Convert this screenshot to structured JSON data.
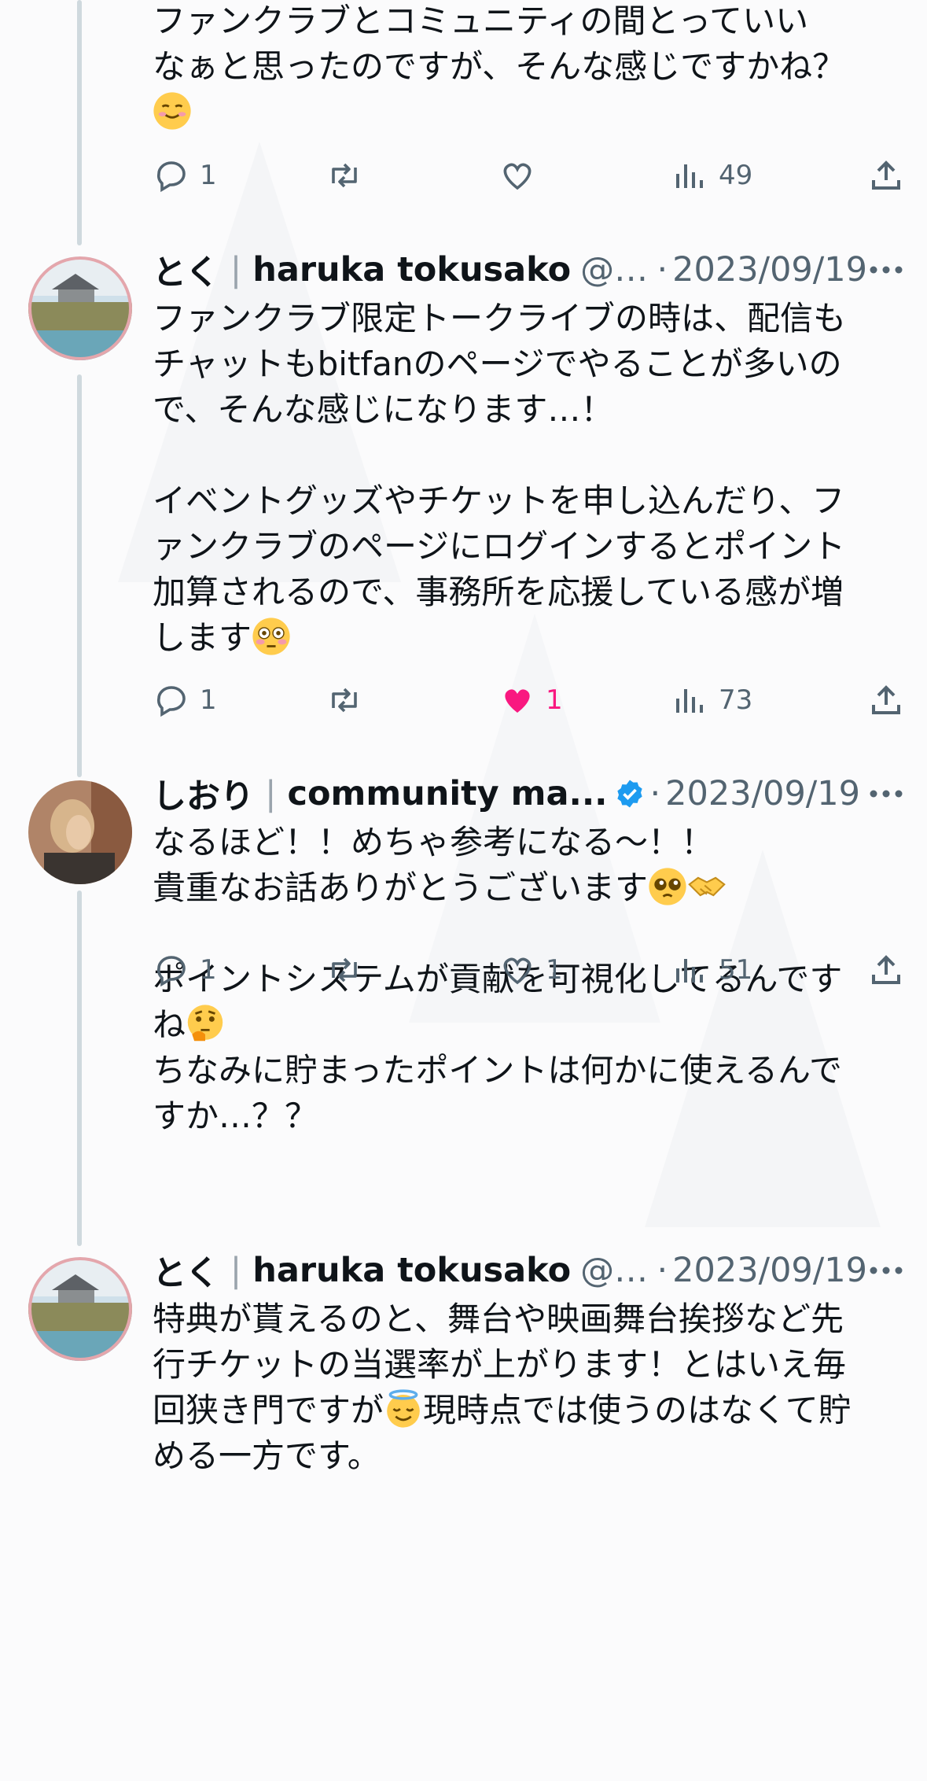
{
  "colors": {
    "like_active": "#f91880",
    "verified": "#1d9bf0",
    "thread_line": "#cfd9de",
    "muted": "#536471"
  },
  "tweets": [
    {
      "text_lines": [
        "ファンクラブとコミュニティの間とっていい",
        "なぁと思ったのですが、そんな感じですかね？"
      ],
      "emoji": "smiling-face-icon",
      "stats": {
        "reply": "1",
        "retweet": "",
        "like": "",
        "views": "49"
      }
    },
    {
      "name": "とく",
      "separator": "|",
      "org": "haruka tokusako",
      "handle": "@t...",
      "dot": "·",
      "date": "2023/09/19",
      "text_lines": [
        "ファンクラブ限定トークライブの時は、配信も",
        "チャットもbitfanのページでやることが多いの",
        "で、そんな感じになります…！",
        "",
        "イベントグッズやチケットを申し込んだり、フ",
        "ァンクラブのページにログインするとポイント",
        "加算されるので、事務所を応援している感が増"
      ],
      "last_line": "します",
      "stats": {
        "reply": "1",
        "retweet": "",
        "like": "1",
        "views": "73"
      }
    },
    {
      "name": "しおり",
      "separator": "|",
      "org": "community ma...",
      "dot": "·",
      "date": "2023/09/19",
      "line1": "なるほど！！めちゃ参考になる〜！！",
      "line2": "貴重なお話ありがとうございます",
      "line3": "ポイントシステムが貢献を可視化してるんです",
      "line4": "ね",
      "line5": "ちなみに貯まったポイントは何かに使えるんで",
      "line6": "すか…？？",
      "stats": {
        "reply": "1",
        "retweet": "",
        "like": "1",
        "views": "51"
      }
    },
    {
      "name": "とく",
      "separator": "|",
      "org": "haruka tokusako",
      "handle": "@t...",
      "dot": "·",
      "date": "2023/09/19",
      "line1": "特典が貰えるのと、舞台や映画舞台挨拶など先",
      "line2": "行チケットの当選率が上がります！とはいえ毎",
      "line3a": "回狭き門ですが",
      "line3b": "現時点では使うのはなくて貯",
      "line4": "める一方です。"
    }
  ]
}
